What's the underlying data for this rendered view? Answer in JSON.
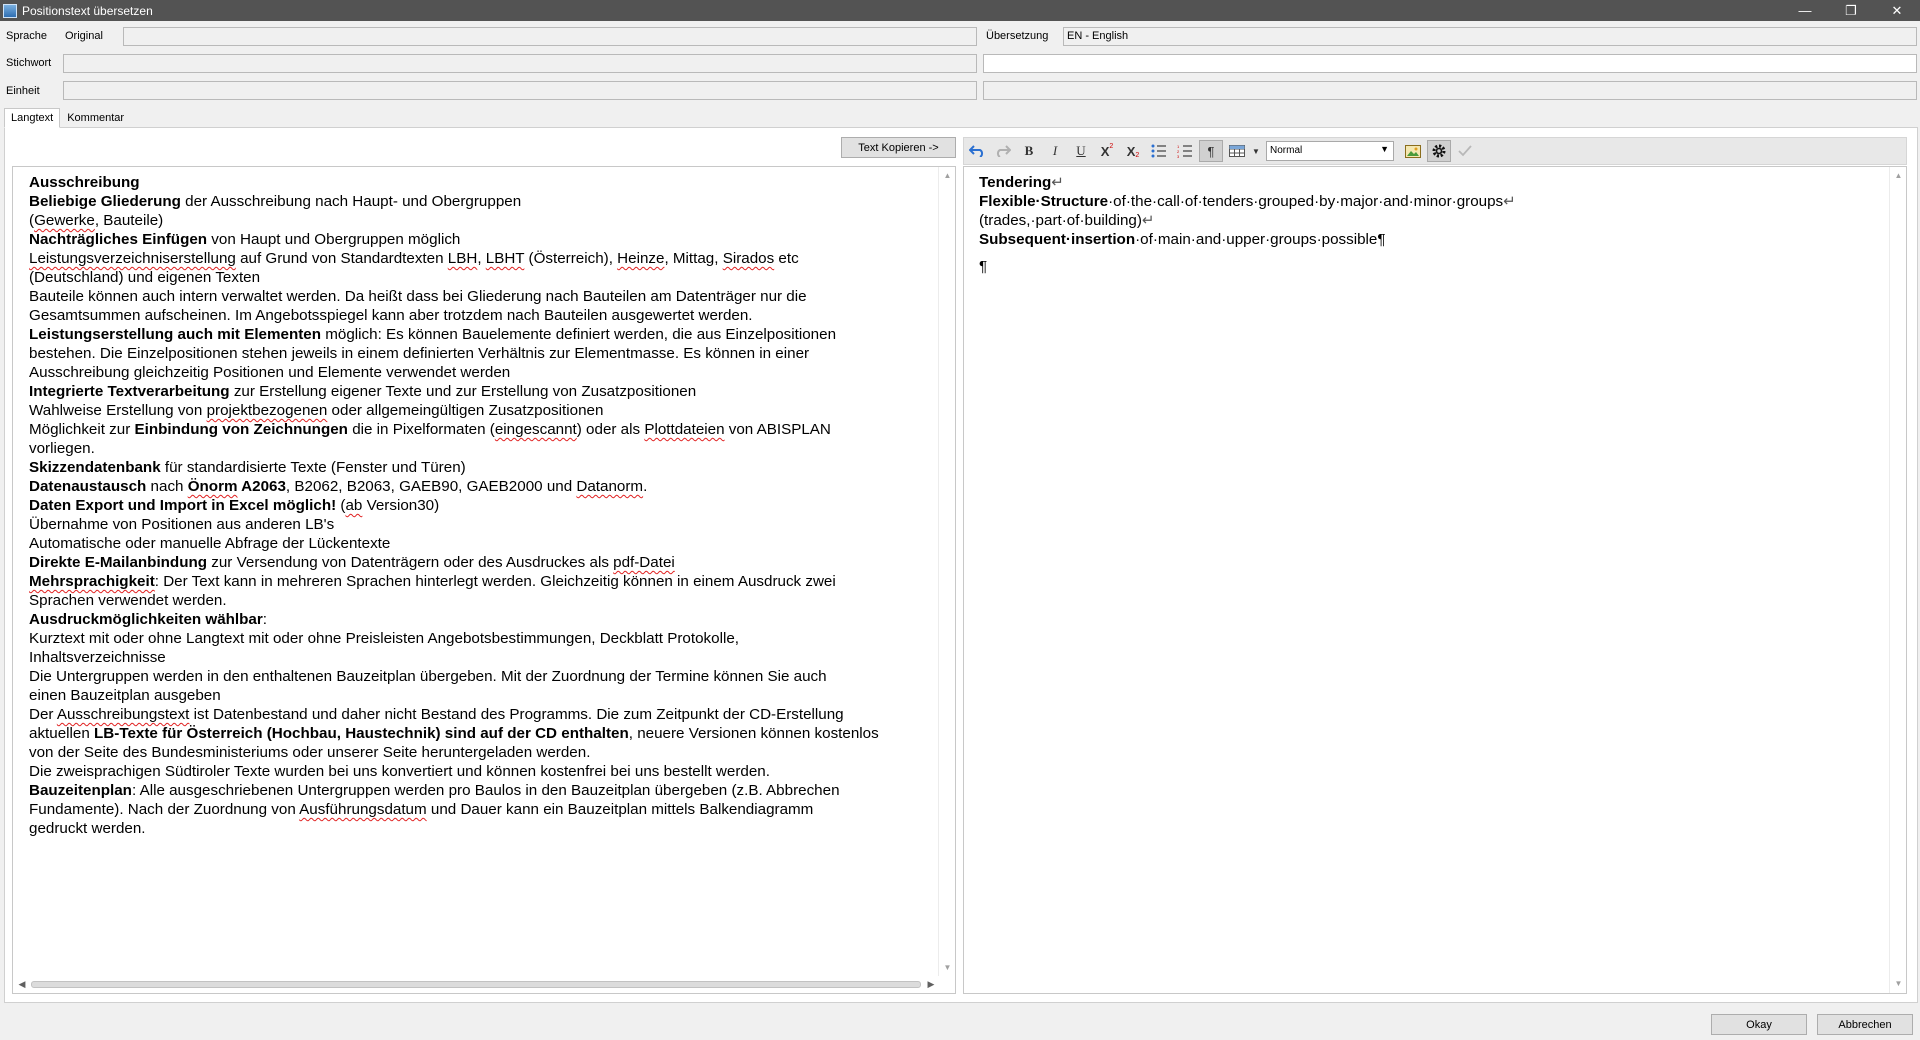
{
  "window": {
    "title": "Positionstext übersetzen",
    "minimize": "—",
    "restore": "❐",
    "close": "✕"
  },
  "header": {
    "sprache_label": "Sprache",
    "original_label": "Original",
    "original_value": "",
    "uebersetzung_label": "Übersetzung",
    "uebersetzung_value": "EN - English",
    "stichwort_label": "Stichwort",
    "stichwort_original": "",
    "stichwort_translation": "",
    "einheit_label": "Einheit",
    "einheit_original": "",
    "einheit_translation": ""
  },
  "tabs": [
    {
      "label": "Langtext"
    },
    {
      "label": "Kommentar"
    }
  ],
  "copy_button": "Text Kopieren ->",
  "toolbar": {
    "style_value": "Normal",
    "paragraph_symbol": "¶"
  },
  "left_text": {
    "l1": "Ausschreibung",
    "l2a": "Beliebige Gliederung",
    "l2b": " der Ausschreibung nach Haupt- und Obergruppen",
    "l3a": "(",
    "l3b": "Gewerke",
    "l3c": ", Bauteile)",
    "l4a": "Nachträgliches Einfügen",
    "l4b": " von Haupt und Obergruppen möglich",
    "l5a": "Leistungsverzeichniserstellung",
    "l5b": " auf Grund von Standardtexten ",
    "l5c": "LBH",
    "l5d": ", ",
    "l5e": "LBHT",
    "l5f": " (Österreich), ",
    "l5g": "Heinze",
    "l5h": ", Mittag, ",
    "l5i": "Sirados",
    "l5j": " etc",
    "l6": "(Deutschland) und eigenen Texten",
    "l7": "Bauteile können auch intern verwaltet werden. Da heißt dass bei Gliederung nach Bauteilen am Datenträger nur die",
    "l8": "Gesamtsummen aufscheinen. Im Angebotsspiegel kann aber trotzdem nach Bauteilen ausgewertet werden.",
    "l9a": "Leistungserstellung",
    "l9b": " auch mit Elementen",
    "l9c": " möglich: Es können Bauelemente definiert werden, die aus Einzelpositionen",
    "l10": "bestehen. Die Einzelpositionen stehen jeweils in einem definierten Verhältnis zur Elementmasse. Es können in einer",
    "l11": "Ausschreibung gleichzeitig Positionen und Elemente verwendet werden",
    "l12a": "Integrierte Textverarbeitung",
    "l12b": " zur Erstellung eigener Texte und zur Erstellung von Zusatzpositionen",
    "l13a": "Wahlweise Erstellung von ",
    "l13b": "projektbezogenen",
    "l13c": " oder allgemeingültigen Zusatzpositionen",
    "l14a": "Möglichkeit zur ",
    "l14b": "Einbindung von Zeichnungen",
    "l14c": " die in Pixelformaten (",
    "l14d": "eingescannt",
    "l14e": ") oder als ",
    "l14f": "Plottdateien",
    "l14g": " von ABISPLAN",
    "l15": "vorliegen.",
    "l16a": "Skizzendatenbank",
    "l16b": " für standardisierte Texte (Fenster und Türen)",
    "l17a": "Datenaustausch",
    "l17b": " nach ",
    "l17c": "Önorm",
    "l17d": " A2063",
    "l17e": ", B2062, B2063, GAEB90, GAEB2000 und ",
    "l17f": "Datanorm",
    "l17g": ".",
    "l18a": "Daten Export und Import in Excel möglich!",
    "l18b": " (",
    "l18c": "ab",
    "l18d": " Version30)",
    "l19": "Übernahme von Positionen aus anderen LB's",
    "l20": "Automatische oder manuelle Abfrage der Lückentexte",
    "l21a": "Direkte E-Mailanbindung",
    "l21b": " zur Versendung von Datenträgern oder des Ausdruckes als ",
    "l21c": "pdf-Datei",
    "l22a": "Mehrsprachigkeit",
    "l22b": ": Der Text kann in mehreren Sprachen hinterlegt werden. Gleichzeitig können in einem Ausdruck zwei",
    "l23": "Sprachen verwendet werden.",
    "l24a": "Ausdruckmöglichkeiten wählbar",
    "l24b": ":",
    "l25": "Kurztext mit oder ohne Langtext mit oder ohne Preisleisten Angebotsbestimmungen, Deckblatt Protokolle,",
    "l26": "Inhaltsverzeichnisse",
    "l27": "Die Untergruppen werden in den enthaltenen Bauzeitplan übergeben. Mit der Zuordnung der Termine können Sie auch",
    "l28": "einen Bauzeitplan ausgeben",
    "l29a": "Der ",
    "l29b": "Ausschreibungstext",
    "l29c": " ist Datenbestand und daher nicht Bestand des Programms. Die zum Zeitpunkt der CD-Erstellung",
    "l30a": "aktuellen ",
    "l30b": "LB-Texte für Österreich (Hochbau, Haustechnik) sind auf der CD enthalten",
    "l30c": ", neuere Versionen können kostenlos",
    "l31": "von der Seite des Bundesministeriums oder unserer Seite heruntergeladen werden.",
    "l32": "Die zweisprachigen Südtiroler Texte wurden bei uns konvertiert und können kostenfrei bei uns bestellt werden.",
    "l33a": "Bauzeitenplan",
    "l33b": ": Alle ausgeschriebenen Untergruppen werden pro Baulos in den Bauzeitplan übergeben (z.B. Abbrechen",
    "l34a": "Fundamente). Nach der Zuordnung von ",
    "l34b": "Ausführungsdatum",
    "l34c": " und Dauer kann ein Bauzeitplan mittels Balkendiagramm",
    "l35": "gedruckt werden."
  },
  "right_text": {
    "r1": "Tendering",
    "r1m": "↵",
    "r2a": "Flexible·Structure",
    "r2b": "·of·the·call·of·tenders·grouped·by·major·and·minor·groups",
    "r2m": "↵",
    "r3": "(trades,·part·of·building)",
    "r3m": "↵",
    "r4a": "Subsequent·insertion",
    "r4b": "·of·main·and·upper·groups·possible",
    "r4m": "¶",
    "r5": "¶"
  },
  "buttons": {
    "okay": "Okay",
    "abbrechen": "Abbrechen"
  }
}
